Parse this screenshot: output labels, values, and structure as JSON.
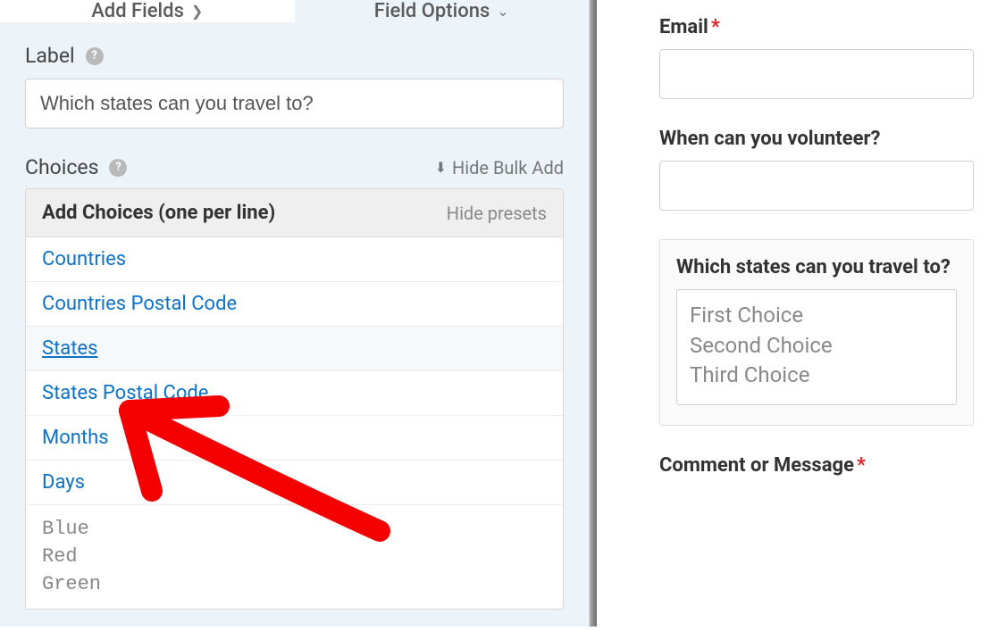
{
  "tabs": {
    "add_fields": "Add Fields",
    "field_options": "Field Options"
  },
  "label": {
    "title": "Label",
    "value": "Which states can you travel to?"
  },
  "choices": {
    "title": "Choices",
    "hide_bulk": "Hide Bulk Add",
    "header_title": "Add Choices (one per line)",
    "hide_presets": "Hide presets",
    "presets": [
      "Countries",
      "Countries Postal Code",
      "States",
      "States Postal Code",
      "Months",
      "Days"
    ],
    "textarea_lines": [
      "Blue",
      "Red",
      "Green"
    ]
  },
  "form_preview": {
    "email": {
      "label": "Email"
    },
    "volunteer": {
      "label": "When can you volunteer?"
    },
    "states": {
      "label": "Which states can you travel to?",
      "options": [
        "First Choice",
        "Second Choice",
        "Third Choice"
      ]
    },
    "comment": {
      "label": "Comment or Message"
    }
  }
}
